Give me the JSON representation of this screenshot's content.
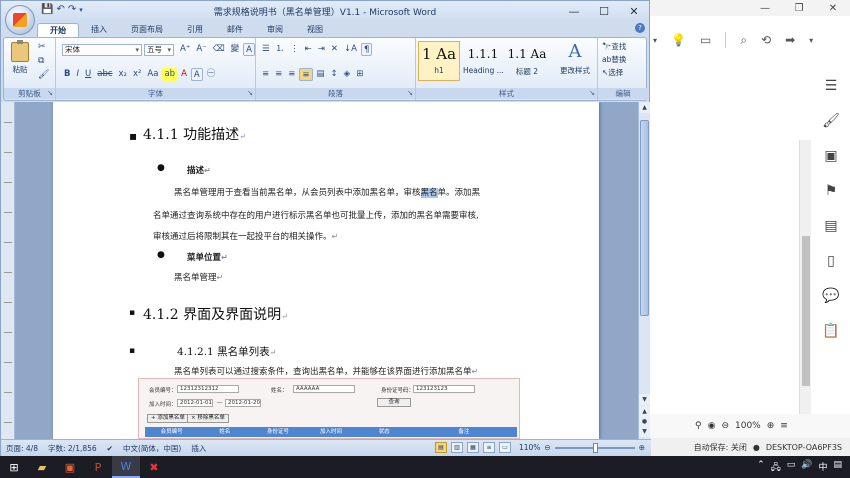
{
  "word": {
    "title": "需求规格说明书（黑名单管理）V1.1 - Microsoft Word",
    "tabs": [
      "开始",
      "插入",
      "页面布局",
      "引用",
      "邮件",
      "审阅",
      "视图"
    ],
    "active_tab": "开始",
    "ribbon": {
      "clipboard": {
        "paste": "粘贴",
        "label": "剪贴板"
      },
      "font": {
        "font_name": "宋体",
        "font_size": "五号",
        "label": "字体"
      },
      "paragraph": {
        "label": "段落"
      },
      "styles": {
        "items": [
          {
            "preview": "1 Aa",
            "name": "h1"
          },
          {
            "preview": "1.1.1",
            "name": "Heading ..."
          },
          {
            "preview": "1.1 Aa",
            "name": "标题 2"
          }
        ],
        "change_styles": "更改样式",
        "label": "样式"
      },
      "editing": {
        "find": "查找",
        "replace": "替换",
        "select": "选择",
        "label": "编辑"
      }
    },
    "document": {
      "h1": "4.1.1 功能描述",
      "bullet_desc": "描述",
      "desc_line1_pre": "黑名单管理用于查看当前黑名单，从会员列表中添加黑名单，审核",
      "desc_line1_hl": "黑名",
      "desc_line1_post": "单。添加黑",
      "desc_line2": "名单通过查询系统中存在的用户进行标示黑名单也可批量上传，添加的黑名单需要审核,",
      "desc_line3": "审核通过后将限制其在一起投平台的相关操作。",
      "bullet_menu": "菜单位置",
      "menu_text": "黑名单管理",
      "h2": "4.1.2 界面及界面说明",
      "h3": "4.1.2.1   黑名单列表",
      "list_desc": "黑名单列表可以通过搜索条件，查询出黑名单，并能够在该界面进行添加黑名单",
      "embed": {
        "member_no_label": "会员编号：",
        "member_no_value": "12312312312",
        "name_label": "姓名：",
        "name_value": "AAAAAA",
        "id_label": "身份证号码：",
        "id_value": "123123123",
        "time_label": "加入时间：",
        "date_from": "2012-01-01",
        "date_sep": "—",
        "date_to": "2012-01-20",
        "query_btn": "查询",
        "add_btn": "添加黑名单",
        "remove_btn": "移除黑名单",
        "columns": [
          "会员编号",
          "姓名",
          "身份证号",
          "加入时间",
          "状态",
          "备注"
        ]
      }
    },
    "status": {
      "page": "页面: 4/8",
      "words": "字数: 2/1,856",
      "language": "中文(简体，中国)",
      "mode": "插入",
      "zoom": "110%"
    }
  },
  "background_app": {
    "zoom": "100%",
    "autosave": "自动保存: 关闭",
    "device": "DESKTOP-OA6PF3S"
  },
  "taskbar": {
    "tray_time": "中"
  }
}
